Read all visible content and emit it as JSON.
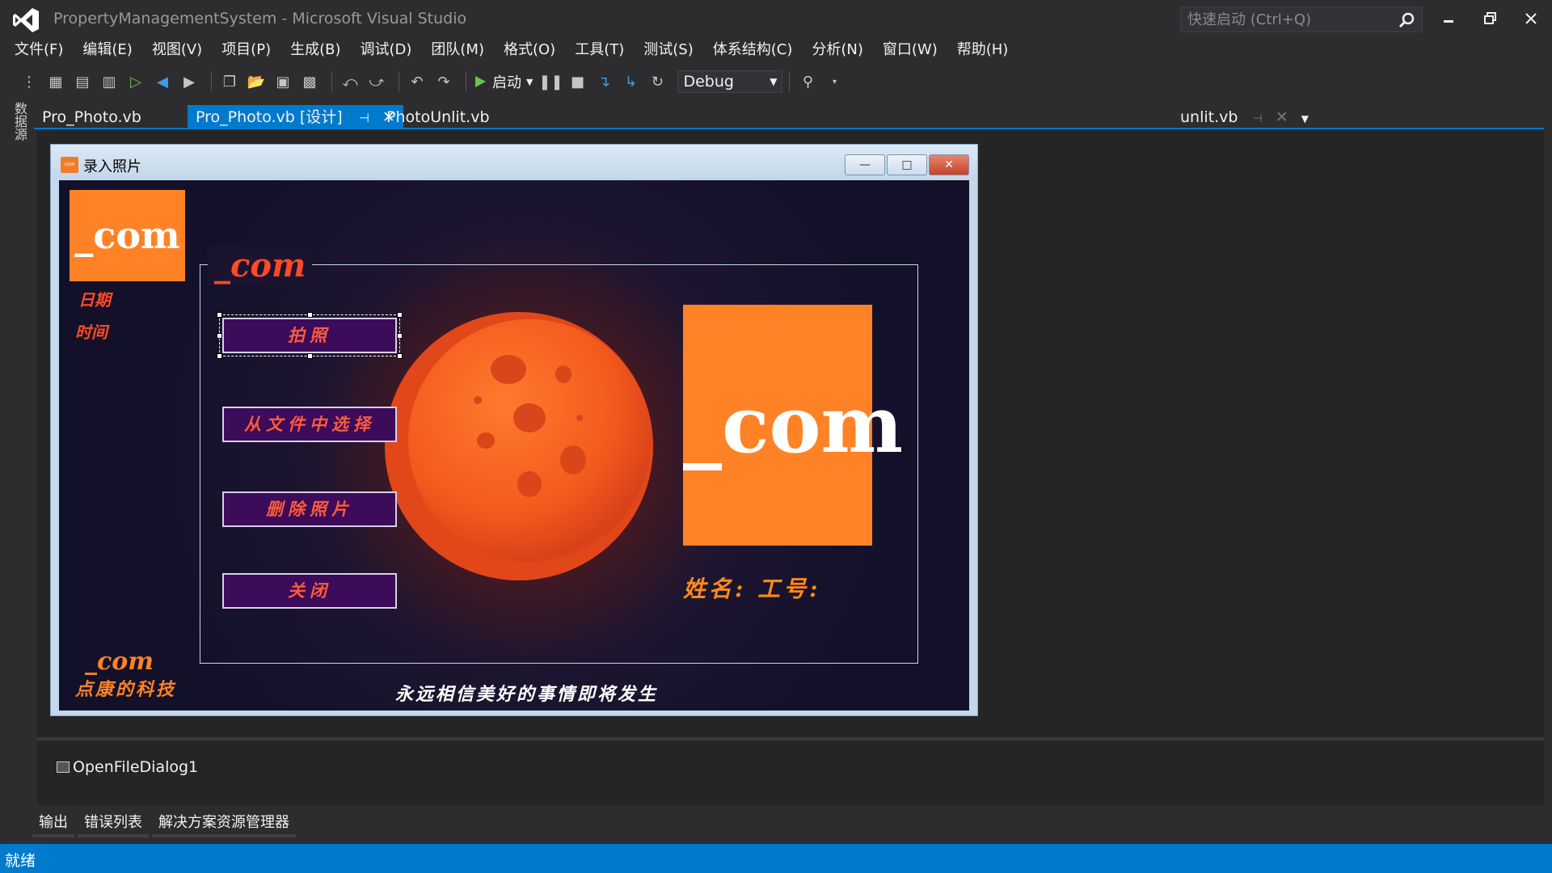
{
  "window": {
    "title": "PropertyManagementSystem - Microsoft Visual Studio",
    "quick_launch_placeholder": "快速启动 (Ctrl+Q)"
  },
  "menu": [
    "文件(F)",
    "编辑(E)",
    "视图(V)",
    "项目(P)",
    "生成(B)",
    "调试(D)",
    "团队(M)",
    "格式(O)",
    "工具(T)",
    "测试(S)",
    "体系结构(C)",
    "分析(N)",
    "窗口(W)",
    "帮助(H)"
  ],
  "toolbar": {
    "start_label": "启动",
    "configuration": "Debug"
  },
  "side_panel": {
    "datasource_label": "数据源"
  },
  "tabs": {
    "items": [
      {
        "label": "Pro_Photo.vb",
        "active": false
      },
      {
        "label": "Pro_Photo.vb [设计]",
        "active": true
      },
      {
        "label": "PhotoUnlit.vb",
        "active": false
      }
    ],
    "right_tab": "unlit.vb"
  },
  "form": {
    "caption": "录入照片",
    "logo_text": "_com",
    "group_title": "_com",
    "date_label": "日期",
    "time_label": "时间",
    "buttons": {
      "take_photo": "拍照",
      "select_file": "从文件中选择",
      "delete_photo": "删除照片",
      "close": "关闭"
    },
    "photo_placeholder_text": "_com",
    "name_id_label": "姓名: 工号:",
    "footer_logo": "_com",
    "company_name": "点康的科技",
    "slogan": "永远相信美好的事情即将发生"
  },
  "component_tray": {
    "item": "OpenFileDialog1"
  },
  "bottom_tabs": [
    "输出",
    "错误列表",
    "解决方案资源管理器"
  ],
  "status": {
    "text": "就绪"
  },
  "colors": {
    "accent": "#007acc",
    "ide_background": "#2d2d30",
    "logo_orange": "#ff8226",
    "calligraphy_red": "#ff4a24",
    "button_purple": "#3c0b5a"
  }
}
